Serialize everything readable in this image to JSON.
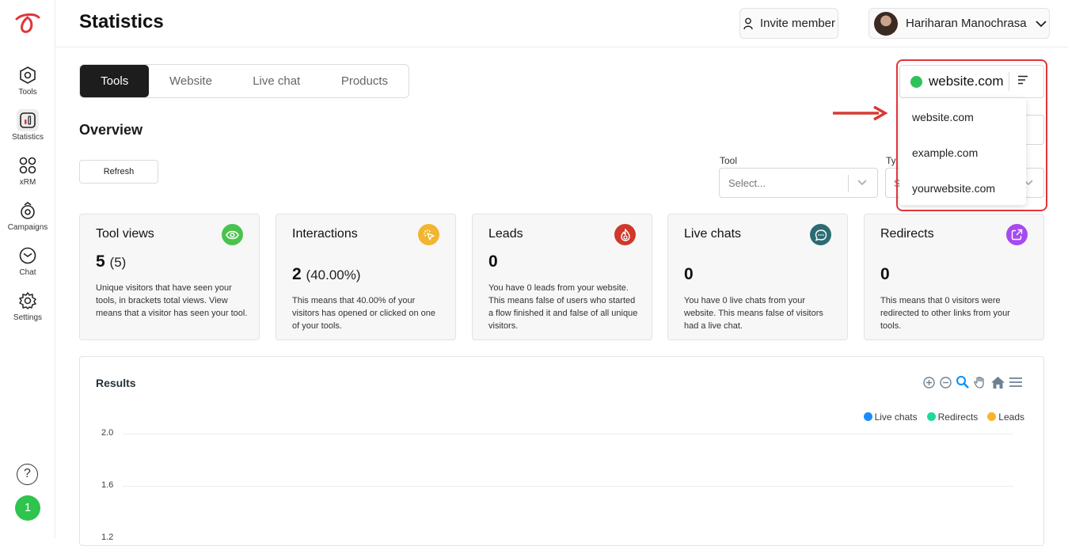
{
  "colors": {
    "accent": "#1d1d1d",
    "brand": "#e0363a",
    "online": "#2fc25b",
    "highlight_box": "#e0363a"
  },
  "sidebar": {
    "items": [
      {
        "label": "Tools",
        "icon": "tools-icon"
      },
      {
        "label": "Statistics",
        "icon": "statistics-icon",
        "active": true
      },
      {
        "label": "xRM",
        "icon": "grid-icon"
      },
      {
        "label": "Campaigns",
        "icon": "campaigns-icon"
      },
      {
        "label": "Chat",
        "icon": "chat-icon"
      },
      {
        "label": "Settings",
        "icon": "gear-icon"
      }
    ],
    "help_glyph": "?",
    "badge": "1"
  },
  "header": {
    "title": "Statistics",
    "invite_label": "Invite member",
    "user_name": "Hariharan Manochrasa"
  },
  "tabs": [
    {
      "label": "Tools",
      "active": true
    },
    {
      "label": "Website"
    },
    {
      "label": "Live chat"
    },
    {
      "label": "Products"
    }
  ],
  "overview": {
    "title": "Overview",
    "refresh_label": "Refresh",
    "tool_filter": {
      "label": "Tool",
      "placeholder": "Select..."
    },
    "type_filter": {
      "label": "Ty",
      "placeholder": "S"
    }
  },
  "cards": [
    {
      "title": "Tool views",
      "value": "5",
      "value_sub": "(5)",
      "desc": "Unique visitors that have seen your tools, in brackets total views. View means that a visitor has seen your tool.",
      "icon": "eye-icon",
      "icon_color": "#4cc24e"
    },
    {
      "title": "Interactions",
      "value": "2",
      "value_sub": "(40.00%)",
      "desc": "This means that 40.00% of your visitors has opened or clicked on one of your tools.",
      "icon": "cursor-click-icon",
      "icon_color": "#f2b531"
    },
    {
      "title": "Leads",
      "value": "0",
      "value_sub": "",
      "desc": "You have 0 leads from your website. This means false of users who started a flow finished it and false of all unique visitors.",
      "icon": "fire-icon",
      "icon_color": "#d0382b"
    },
    {
      "title": "Live chats",
      "value": "0",
      "value_sub": "",
      "desc": "You have 0 live chats from your website. This means false of visitors had a live chat.",
      "icon": "chat-bubble-icon",
      "icon_color": "#2b6c73"
    },
    {
      "title": "Redirects",
      "value": "0",
      "value_sub": "",
      "desc": "This means that 0 visitors were redirected to other links from your tools.",
      "icon": "external-link-icon",
      "icon_color": "#a64bf0"
    }
  ],
  "results": {
    "title": "Results",
    "toolbar": [
      "zoom-in-icon",
      "zoom-out-icon",
      "magnifier-icon",
      "pan-hand-icon",
      "home-icon",
      "menu-icon"
    ]
  },
  "chart_data": {
    "type": "line",
    "title": "Results",
    "series": [
      {
        "name": "Live chats",
        "color": "#1a8cff",
        "values": []
      },
      {
        "name": "Redirects",
        "color": "#1ed99a",
        "values": []
      },
      {
        "name": "Leads",
        "color": "#f7b52c",
        "values": []
      }
    ],
    "y_ticks": [
      "2.0",
      "1.6",
      "1.2"
    ],
    "legend": "top-right",
    "grid": true
  },
  "website_selector": {
    "selected": "website.com",
    "options": [
      "website.com",
      "example.com",
      "yourwebsite.com"
    ]
  }
}
